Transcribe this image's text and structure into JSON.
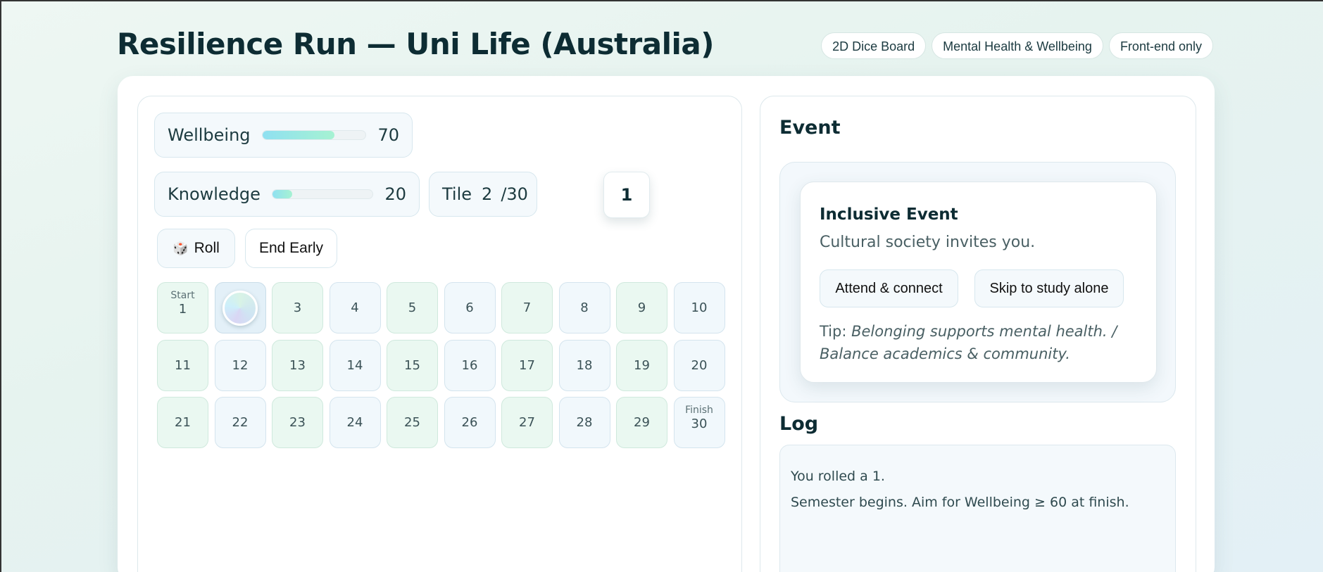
{
  "title": "Resilience Run — Uni Life (Australia)",
  "tags": [
    "2D Dice Board",
    "Mental Health & Wellbeing",
    "Front-end only"
  ],
  "stats": {
    "wellbeing": {
      "label": "Wellbeing",
      "value": "70",
      "fill_fraction": 0.7
    },
    "knowledge": {
      "label": "Knowledge",
      "value": "20",
      "fill_fraction": 0.2
    },
    "tile": {
      "label": "Tile",
      "current": "2",
      "total": "/30"
    },
    "dice_value": "1"
  },
  "controls": {
    "roll_icon": "🎲",
    "roll_label": "Roll",
    "end_label": "End Early"
  },
  "board": {
    "start_tag": "Start",
    "finish_tag": "Finish",
    "current_tile": 2,
    "tiles": [
      "1",
      "2",
      "3",
      "4",
      "5",
      "6",
      "7",
      "8",
      "9",
      "10",
      "11",
      "12",
      "13",
      "14",
      "15",
      "16",
      "17",
      "18",
      "19",
      "20",
      "21",
      "22",
      "23",
      "24",
      "25",
      "26",
      "27",
      "28",
      "29",
      "30"
    ]
  },
  "event": {
    "heading": "Event",
    "title": "Inclusive Event",
    "description": "Cultural society invites you.",
    "option_a": "Attend & connect",
    "option_b": "Skip to study alone",
    "tip_prefix": "Tip:",
    "tip_text": "Belonging supports mental health. / Balance academics & community."
  },
  "log": {
    "heading": "Log",
    "entries": [
      "You rolled a 1.",
      "Semester begins. Aim for Wellbeing ≥ 60 at finish."
    ]
  }
}
